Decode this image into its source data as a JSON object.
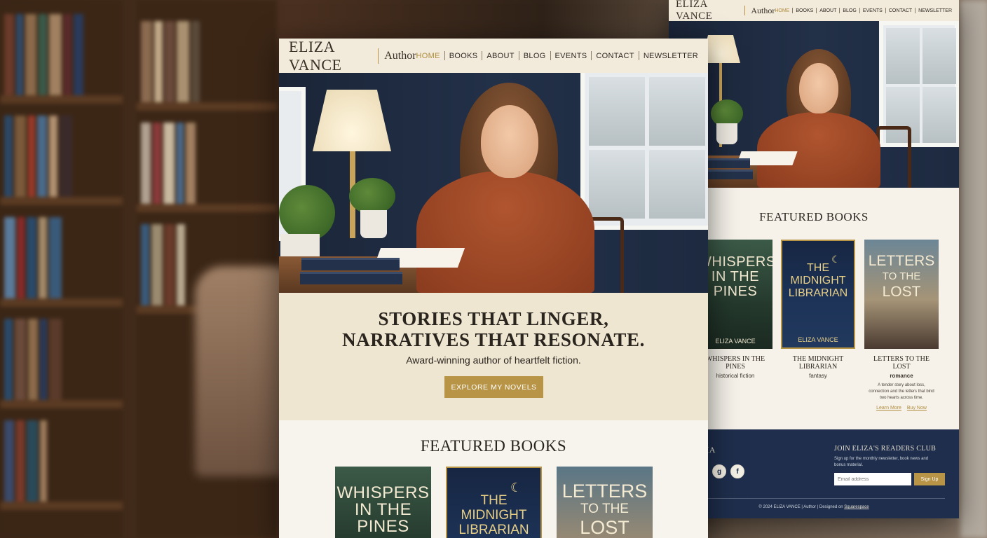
{
  "brand": {
    "name": "ELIZA VANCE",
    "role": "Author"
  },
  "nav": {
    "items": [
      "HOME",
      "BOOKS",
      "ABOUT",
      "BLOG",
      "EVENTS",
      "CONTACT",
      "NEWSLETTER"
    ],
    "active": "HOME"
  },
  "hero": {
    "headline_line1": "STORIES THAT LINGER,",
    "headline_line2": "NARRATIVES THAT RESONATE.",
    "tagline": "Award-winning author of heartfelt fiction.",
    "cta": "EXPLORE MY NOVELS"
  },
  "featured": {
    "heading": "FEATURED BOOKS",
    "books": [
      {
        "cover_line1": "WHISPERS",
        "cover_line2": "IN THE",
        "cover_line3": "PINES",
        "cover_author": "ELIZA VANCE",
        "title": "WHISPERS IN THE PINES",
        "genre": "historical fiction"
      },
      {
        "cover_line1": "THE",
        "cover_line2": "MIDNIGHT",
        "cover_line3": "LIBRARIAN",
        "cover_author": "ELIZA VANCE",
        "title": "THE MIDNIGHT LIBRARIAN",
        "genre": "fantasy"
      },
      {
        "cover_line1": "LETTERS",
        "cover_line2": "TO THE",
        "cover_line3": "LOST",
        "cover_author": "",
        "title": "LETTERS TO THE LOST",
        "genre": "romance",
        "description": "A tender story about loss, connection and the letters that bind two hearts across time.",
        "learn_more": "Learn More",
        "buy_now": "Buy Now"
      }
    ]
  },
  "footer": {
    "social_heading": "CIAL MEDIA",
    "join_heading": "JOIN ELIZA'S READERS CLUB",
    "join_desc": "Sign up for the monthly newsletter, book news and bonus material.",
    "email_placeholder": "Email address",
    "signup": "Sign Up",
    "copyright": "© 2024 ELIZA VANCE | Author | Designed on",
    "designer": "Squarespace"
  },
  "colors": {
    "header_bg": "#f2ebdc",
    "accent_gold": "#b89446",
    "footer_navy": "#1e2e4c",
    "sweater": "#a04a26"
  },
  "icons": [
    "instagram-icon",
    "goodreads-icon",
    "facebook-icon"
  ]
}
